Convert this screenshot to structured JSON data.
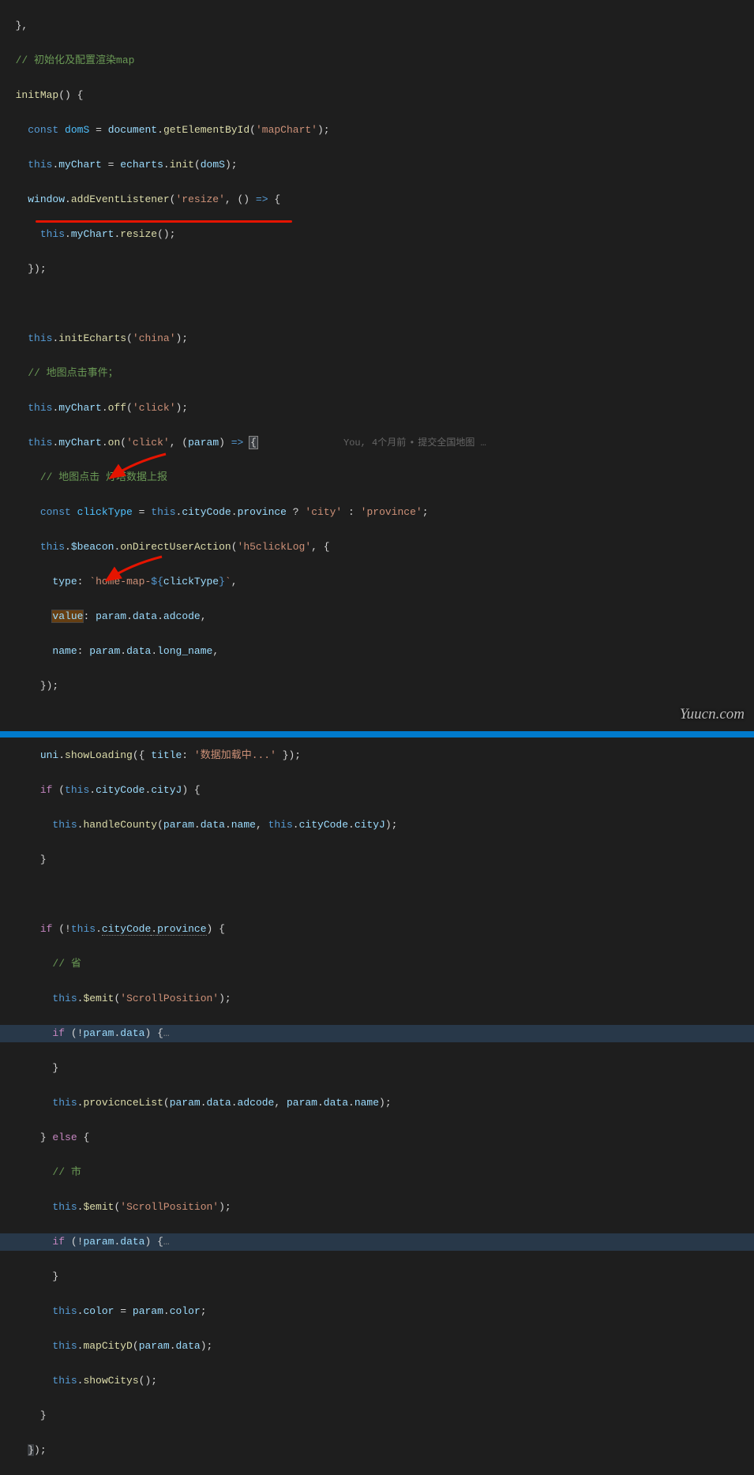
{
  "blame": {
    "author": "You",
    "when": "4个月前",
    "message": "提交全国地图 …"
  },
  "watermark": "Yuucn.com",
  "code": {
    "l1": "},",
    "comment_init": "// 初始化及配置渲染map",
    "initMap": "initMap",
    "const": "const",
    "domS": "domS",
    "document": "document",
    "getElementById": "getElementById",
    "mapChart": "'mapChart'",
    "this": "this",
    "myChart": "myChart",
    "echarts": "echarts",
    "init": "init",
    "window": "window",
    "addEventListener": "addEventListener",
    "resize_str": "'resize'",
    "resize": "resize",
    "initEcharts": "initEcharts",
    "china": "'china'",
    "comment_click_event": "// 地图点击事件；",
    "off": "off",
    "click": "'click'",
    "on": "on",
    "param": "param",
    "comment_click_beacon": "// 地图点击 灯塔数据上报",
    "clickType": "clickType",
    "cityCode": "cityCode",
    "province": "province",
    "city_str": "'city'",
    "province_str": "'province'",
    "beacon": "$beacon",
    "onDirectUserAction": "onDirectUserAction",
    "h5clickLog": "'h5clickLog'",
    "type": "type",
    "template_str1": "`home-map-",
    "template_str2": "`",
    "value": "value",
    "data": "data",
    "adcode": "adcode",
    "name": "name",
    "long_name": "long_name",
    "uni": "uni",
    "showLoading": "showLoading",
    "title": "title",
    "loading_str": "'数据加载中...'",
    "if": "if",
    "cityJ": "cityJ",
    "handleCounty": "handleCounty",
    "comment_province": "// 省",
    "emit": "$emit",
    "scrollPosition": "'ScrollPosition'",
    "provicnceList": "provicnceList",
    "else": "else",
    "comment_city": "// 市",
    "color": "color",
    "mapCityD": "mapCityD",
    "showCitys": "showCitys",
    "fold": "…"
  }
}
